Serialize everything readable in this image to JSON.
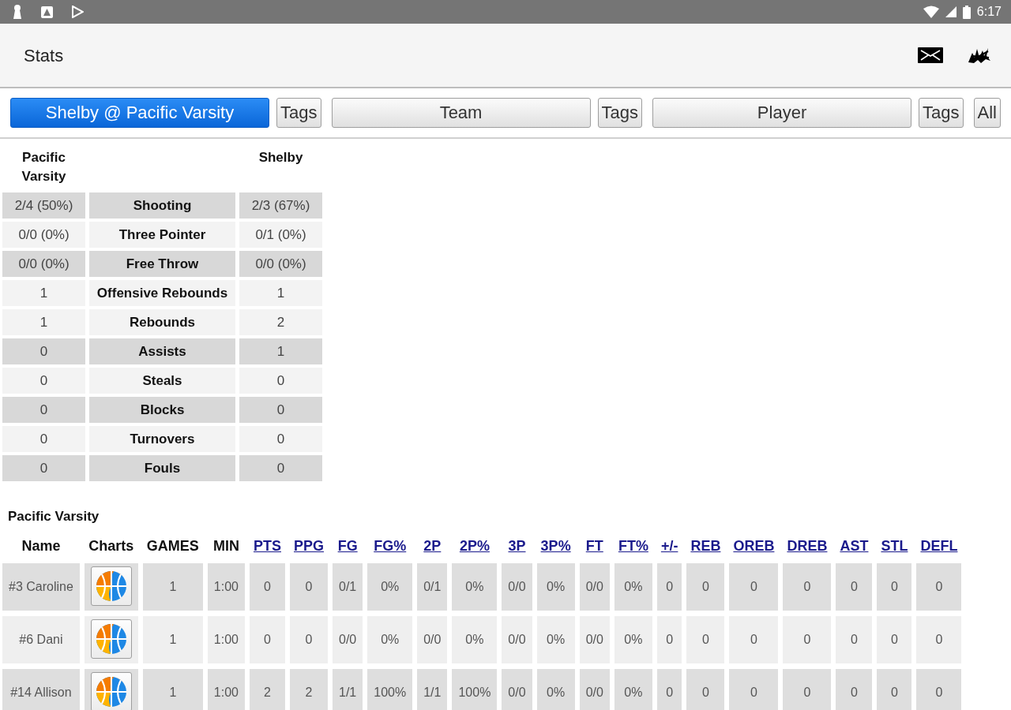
{
  "status_bar": {
    "time": "6:17"
  },
  "app_bar": {
    "title": "Stats"
  },
  "tabs": [
    {
      "label": "Shelby @ Pacific Varsity",
      "kind": "wide",
      "selected": true
    },
    {
      "label": "Tags",
      "kind": "narrow",
      "selected": false
    },
    {
      "label": "Team",
      "kind": "wide",
      "selected": false
    },
    {
      "label": "Tags",
      "kind": "narrow",
      "selected": false
    },
    {
      "label": "Player",
      "kind": "wide",
      "selected": false
    },
    {
      "label": "Tags",
      "kind": "narrow",
      "selected": false
    },
    {
      "label": "All",
      "kind": "narrow",
      "selected": false
    }
  ],
  "summary": {
    "home_team": "Pacific Varsity",
    "away_team": "Shelby",
    "rows": [
      {
        "home": "2/4 (50%)",
        "stat": "Shooting",
        "away": "2/3 (67%)",
        "shaded": true
      },
      {
        "home": "0/0 (0%)",
        "stat": "Three Pointer",
        "away": "0/1 (0%)",
        "shaded": false
      },
      {
        "home": "0/0 (0%)",
        "stat": "Free Throw",
        "away": "0/0 (0%)",
        "shaded": true
      },
      {
        "home": "1",
        "stat": "Offensive Rebounds",
        "away": "1",
        "shaded": false
      },
      {
        "home": "1",
        "stat": "Rebounds",
        "away": "2",
        "shaded": false
      },
      {
        "home": "0",
        "stat": "Assists",
        "away": "1",
        "shaded": true
      },
      {
        "home": "0",
        "stat": "Steals",
        "away": "0",
        "shaded": false
      },
      {
        "home": "0",
        "stat": "Blocks",
        "away": "0",
        "shaded": true
      },
      {
        "home": "0",
        "stat": "Turnovers",
        "away": "0",
        "shaded": false
      },
      {
        "home": "0",
        "stat": "Fouls",
        "away": "0",
        "shaded": true
      }
    ]
  },
  "players": {
    "team": "Pacific Varsity",
    "columns": [
      {
        "label": "Name",
        "kind": "text",
        "link": false
      },
      {
        "label": "Charts",
        "kind": "chart",
        "link": false
      },
      {
        "label": "GAMES",
        "kind": "text",
        "link": false
      },
      {
        "label": "MIN",
        "kind": "text",
        "link": false
      },
      {
        "label": "PTS",
        "kind": "text",
        "link": true
      },
      {
        "label": "PPG",
        "kind": "text",
        "link": true
      },
      {
        "label": "FG",
        "kind": "text",
        "link": true
      },
      {
        "label": "FG%",
        "kind": "text",
        "link": true
      },
      {
        "label": "2P",
        "kind": "text",
        "link": true
      },
      {
        "label": "2P%",
        "kind": "text",
        "link": true
      },
      {
        "label": "3P",
        "kind": "text",
        "link": true
      },
      {
        "label": "3P%",
        "kind": "text",
        "link": true
      },
      {
        "label": "FT",
        "kind": "text",
        "link": true
      },
      {
        "label": "FT%",
        "kind": "text",
        "link": true
      },
      {
        "label": "+/-",
        "kind": "text",
        "link": true
      },
      {
        "label": "REB",
        "kind": "text",
        "link": true
      },
      {
        "label": "OREB",
        "kind": "text",
        "link": true
      },
      {
        "label": "DREB",
        "kind": "text",
        "link": true
      },
      {
        "label": "AST",
        "kind": "text",
        "link": true
      },
      {
        "label": "STL",
        "kind": "text",
        "link": true
      },
      {
        "label": "DEFL",
        "kind": "text",
        "link": true
      }
    ],
    "rows": [
      {
        "cells": [
          "#3 Caroline",
          "",
          "1",
          "1:00",
          "0",
          "0",
          "0/1",
          "0%",
          "0/1",
          "0%",
          "0/0",
          "0%",
          "0/0",
          "0%",
          "0",
          "0",
          "0",
          "0",
          "0",
          "0",
          "0"
        ]
      },
      {
        "cells": [
          "#6 Dani",
          "",
          "1",
          "1:00",
          "0",
          "0",
          "0/0",
          "0%",
          "0/0",
          "0%",
          "0/0",
          "0%",
          "0/0",
          "0%",
          "0",
          "0",
          "0",
          "0",
          "0",
          "0",
          "0"
        ]
      },
      {
        "cells": [
          "#14 Allison",
          "",
          "1",
          "1:00",
          "2",
          "2",
          "1/1",
          "100%",
          "1/1",
          "100%",
          "0/0",
          "0%",
          "0/0",
          "0%",
          "0",
          "0",
          "0",
          "0",
          "0",
          "0",
          "0"
        ]
      }
    ]
  }
}
